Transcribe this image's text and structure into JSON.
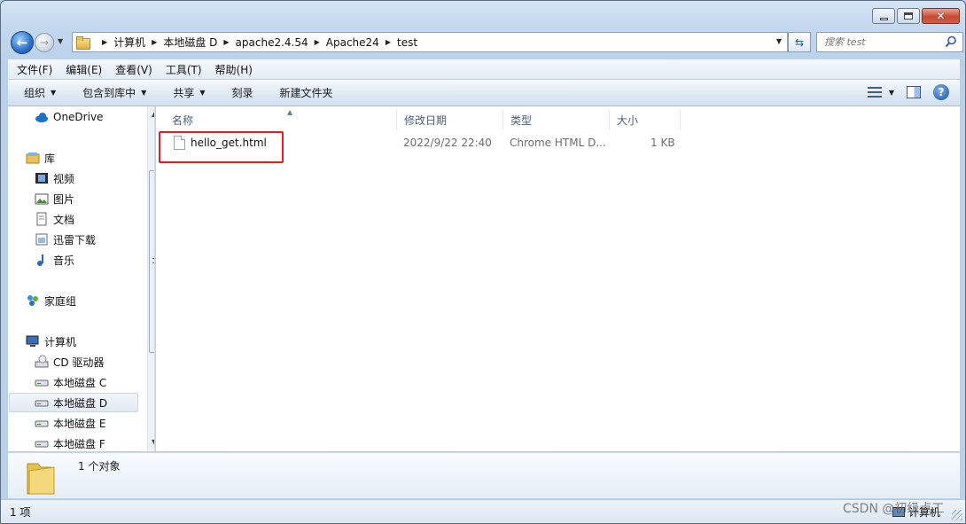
{
  "address_bar": {
    "crumbs": [
      "计算机",
      "本地磁盘 D",
      "apache2.4.54",
      "Apache24",
      "test"
    ]
  },
  "search": {
    "placeholder": "搜索 test"
  },
  "menu": [
    "文件(F)",
    "编辑(E)",
    "查看(V)",
    "工具(T)",
    "帮助(H)"
  ],
  "toolbar": {
    "organize": "组织",
    "include_in_library": "包含到库中",
    "share": "共享",
    "burn": "刻录",
    "new_folder": "新建文件夹"
  },
  "nav": {
    "onedrive": "OneDrive",
    "libraries": "库",
    "videos": "视频",
    "pictures": "图片",
    "documents": "文档",
    "thunder": "迅雷下载",
    "music": "音乐",
    "homegroup": "家庭组",
    "computer": "计算机",
    "cd_drive": "CD 驱动器",
    "disk_c": "本地磁盘 C",
    "disk_d": "本地磁盘 D",
    "disk_e": "本地磁盘 E",
    "disk_f": "本地磁盘 F"
  },
  "columns": {
    "name": "名称",
    "modified": "修改日期",
    "type": "类型",
    "size": "大小"
  },
  "files": [
    {
      "name": "hello_get.html",
      "modified": "2022/9/22 22:40",
      "type": "Chrome HTML D...",
      "size": "1 KB"
    }
  ],
  "details": {
    "count": "1 个对象"
  },
  "status": {
    "items": "1 项",
    "location": "计算机"
  },
  "watermark": "CSDN @初级点工",
  "colors": {
    "highlight": "#e02020",
    "accent": "#2a6fc9"
  },
  "icons": {
    "back": "back-arrow-icon",
    "forward": "forward-arrow-icon",
    "refresh": "refresh-icon",
    "search": "search-icon",
    "help": "help-icon",
    "file": "html-document-icon"
  }
}
